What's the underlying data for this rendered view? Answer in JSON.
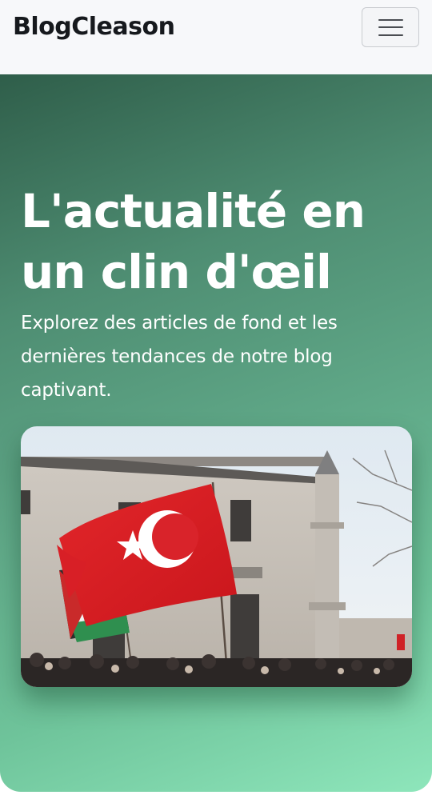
{
  "navbar": {
    "brand": "BlogCleason",
    "menu_icon": "hamburger-menu-icon"
  },
  "hero": {
    "title": "L'actualité en un clin d'œil",
    "subtitle": "Explorez des articles de fond et les dernières tendances de notre blog captivant.",
    "gradient_start": "#2f5e4a",
    "gradient_end": "#8ee6bb",
    "image_subject": "turkish-and-palestinian-flags-at-mosque-photo"
  },
  "colors": {
    "navbar_bg": "#f7f8fa",
    "brand_text": "#16191d",
    "hero_text": "#ffffff"
  }
}
